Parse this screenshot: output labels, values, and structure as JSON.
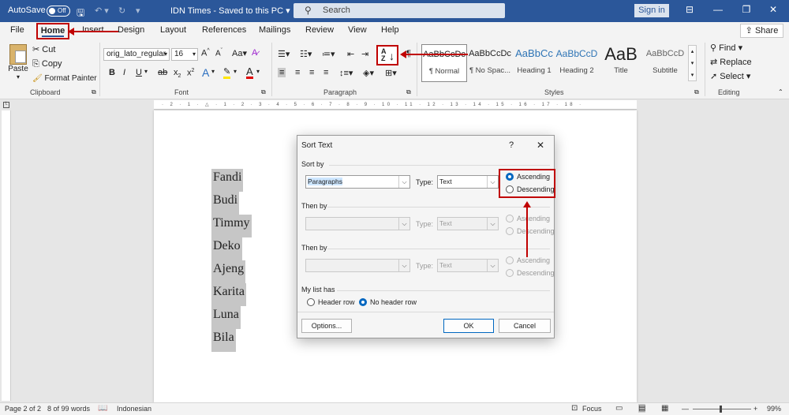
{
  "titlebar": {
    "autosave": "AutoSave",
    "toggle": "Off",
    "doc_title": "IDN Times  -  Saved to this PC",
    "search": "Search",
    "signin": "Sign in"
  },
  "tabs": {
    "file": "File",
    "home": "Home",
    "insert": "Insert",
    "design": "Design",
    "layout": "Layout",
    "references": "References",
    "mailings": "Mailings",
    "review": "Review",
    "view": "View",
    "help": "Help",
    "share": "Share"
  },
  "ribbon": {
    "clipboard": {
      "paste": "Paste",
      "cut": "Cut",
      "copy": "Copy",
      "format_painter": "Format Painter",
      "label": "Clipboard"
    },
    "font": {
      "name": "orig_lato_regular",
      "size": "16",
      "label": "Font"
    },
    "paragraph": {
      "label": "Paragraph"
    },
    "styles": {
      "label": "Styles",
      "items": [
        {
          "preview": "AaBbCcDc",
          "name": "¶ Normal"
        },
        {
          "preview": "AaBbCcDc",
          "name": "¶ No Spac..."
        },
        {
          "preview": "AaBbCc",
          "name": "Heading 1"
        },
        {
          "preview": "AaBbCcD",
          "name": "Heading 2"
        },
        {
          "preview": "AaB",
          "name": "Title"
        },
        {
          "preview": "AaBbCcD",
          "name": "Subtitle"
        }
      ]
    },
    "editing": {
      "find": "Find",
      "replace": "Replace",
      "select": "Select",
      "label": "Editing"
    }
  },
  "ruler": "· 2 · 1 · △ · 1 · 2 · 3 · 4 · 5 · 6 · 7 · 8 · 9 · 10 · 11 · 12 · 13 · 14 · 15 · 16 · 17 · 18 ·",
  "document": {
    "items": [
      "Fandi",
      "Budi",
      "Timmy",
      "Deko",
      "Ajeng",
      "Karita",
      "Luna",
      "Bila"
    ]
  },
  "dialog": {
    "title": "Sort Text",
    "help": "?",
    "close": "✕",
    "sort_by": "Sort by",
    "sort_field": "Paragraphs",
    "type_label": "Type:",
    "type_value": "Text",
    "then_by_1": "Then by",
    "then_by_2": "Then by",
    "ascending": "Ascending",
    "descending": "Descending",
    "my_list_has": "My list has",
    "header_row": "Header row",
    "no_header_row": "No header row",
    "options": "Options...",
    "ok": "OK",
    "cancel": "Cancel"
  },
  "status": {
    "page": "Page 2 of 2",
    "words": "8 of 99 words",
    "language": "Indonesian",
    "focus": "Focus",
    "zoom": "99%"
  },
  "colors": {
    "accent": "#2b579a",
    "highlight": "#c00000"
  }
}
